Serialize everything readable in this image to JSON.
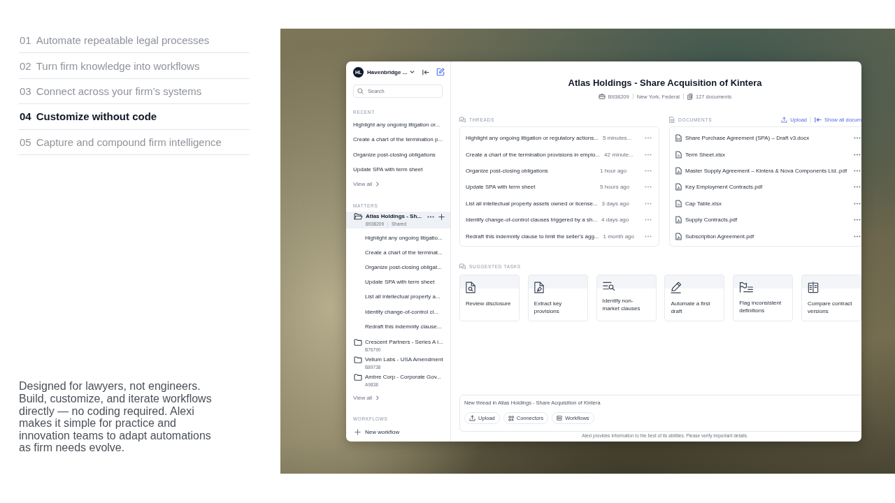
{
  "features": {
    "items": [
      {
        "number": "01",
        "label": "Automate repeatable legal processes",
        "selected": false
      },
      {
        "number": "02",
        "label": "Turn firm knowledge into workflows",
        "selected": false
      },
      {
        "number": "03",
        "label": "Connect across your firm’s systems",
        "selected": false
      },
      {
        "number": "04",
        "label": "Customize without code",
        "selected": true
      },
      {
        "number": "05",
        "label": "Capture and compound firm intelligence",
        "selected": false
      }
    ],
    "description": "Designed for lawyers, not engineers. Build, customize, and iterate workflows directly — no coding required. Alexi makes it simple for practice and innovation teams to adapt automations as firm needs evolve."
  },
  "app": {
    "sidebar": {
      "workspace": {
        "initials": "HL",
        "name": "Havenbridge ..."
      },
      "search": {
        "placeholder": "Search"
      },
      "recent": {
        "heading": "RECENT",
        "items": [
          "Highlight any ongoing litigation or...",
          "Create a chart of the termination p...",
          "Organize post-closing obligations",
          "Update SPA with term sheet"
        ],
        "view_all": "View all"
      },
      "matters": {
        "heading": "MATTERS",
        "items": [
          {
            "title": "Atlas Holdings - Sh...",
            "number": "B938209",
            "sharing": "Shared",
            "selected": true,
            "expanded": true,
            "children": [
              "Highlight any ongoing litigatio...",
              "Create a chart of the terminat...",
              "Organize post-closing obligat...",
              "Update SPA with term sheet",
              "List all intellectual property a...",
              "Identify change-of-control cl...",
              "Redraft this indemnity clause..."
            ]
          },
          {
            "title": "Crescent Partners - Series A i...",
            "number": "B76790",
            "selected": false,
            "expanded": false
          },
          {
            "title": "Vellum Labs - USA Amendment",
            "number": "B89738",
            "selected": false,
            "expanded": false
          },
          {
            "title": "Ambre Corp - Corporate Gov...",
            "number": "A9838",
            "selected": false,
            "expanded": false
          }
        ],
        "view_all": "View all"
      },
      "workflows": {
        "heading": "WORKFLOWS",
        "action": "New workflow"
      }
    },
    "header": {
      "title": "Atlas Holdings - Share Acquisition of Kintera",
      "number": "B938209",
      "location": "New York, Federal",
      "documents": "127 documents"
    },
    "threads": {
      "heading": "THREADS",
      "items": [
        {
          "title": "Highlight any ongoing litigation or regulatory actions...",
          "time": "5 minutes..."
        },
        {
          "title": "Create a chart of the termination provisions in emplo...",
          "time": "42 minute..."
        },
        {
          "title": "Organize post-closing obligations",
          "time": "1 hour ago"
        },
        {
          "title": "Update SPA with term sheet",
          "time": "5 hours ago"
        },
        {
          "title": "List all intellectual property assets owned or license...",
          "time": "3 days ago"
        },
        {
          "title": "Identify change-of-control clauses triggered by a sh...",
          "time": "4 days ago"
        },
        {
          "title": "Redraft this indemnity clause to limit the seller's agg...",
          "time": "1 month ago"
        }
      ]
    },
    "documents": {
      "heading": "DOCUMENTS",
      "upload": "Upload",
      "show_all": "Show all docum",
      "items": [
        {
          "name": "Share Purchase Agreement (SPA) – Draft v3.docx",
          "kind": "word"
        },
        {
          "name": "Term Sheet.xlsx",
          "kind": "sheet"
        },
        {
          "name": "Master Supply Agreement – Kintera & Nova Components Ltd..pdf",
          "kind": "pdf"
        },
        {
          "name": "Key Employment Contracts.pdf",
          "kind": "pdf"
        },
        {
          "name": "Cap Table.xlsx",
          "kind": "sheet"
        },
        {
          "name": "Supply Contracts.pdf",
          "kind": "pdf"
        },
        {
          "name": "Subscription Agreement.pdf",
          "kind": "pdf"
        }
      ]
    },
    "suggested_tasks": {
      "heading": "SUGGESTED TASKS",
      "items": [
        "Review disclosure",
        "Extract key provisions",
        "Identify non-market clauses",
        "Automate a first draft",
        "Flag inconsistent definitions",
        "Compare contract versions"
      ]
    },
    "composer": {
      "placeholder": "New thread in Atlas Holdings - Share Acquisition of Kintera",
      "buttons": [
        "Upload",
        "Connectors",
        "Workflows"
      ]
    },
    "disclaimer": "Alexi provides information to the best of its abilities. Please verify important details."
  }
}
